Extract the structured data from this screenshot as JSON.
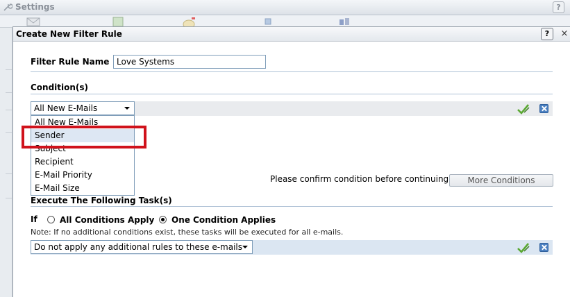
{
  "background": {
    "title": "Settings",
    "help_label": "?"
  },
  "dialog": {
    "title": "Create New Filter Rule",
    "help_label": "?",
    "close_label": "×"
  },
  "rule_name": {
    "label": "Filter Rule Name",
    "value": "Love Systems"
  },
  "conditions": {
    "heading": "Condition(s)",
    "selected": "All New E-Mails",
    "options": [
      "All New E-Mails",
      "Sender",
      "Subject",
      "Recipient",
      "E-Mail Priority",
      "E-Mail Size"
    ],
    "highlighted_index": 1,
    "confirm_text": "Please confirm condition before continuing.",
    "more_button": "More Conditions"
  },
  "tasks": {
    "heading": "Execute The Following Task(s)",
    "if_label": "If",
    "option_all": "All Conditions Apply",
    "option_one": "One Condition Applies",
    "selected_option": "one",
    "note": "Note: If no additional conditions exist, these tasks will be executed for all e-mails.",
    "task_selected": "Do not apply any additional rules to these e-mails"
  },
  "colors": {
    "highlight": "#d0121b",
    "rule_line": "#aec1d6",
    "check_green": "#5aa832",
    "delete_blue": "#4a7fc0"
  },
  "icons": [
    "wrench-icon",
    "help-icon",
    "close-icon",
    "chevron-down-icon",
    "checkmark-edit-icon",
    "delete-icon"
  ]
}
